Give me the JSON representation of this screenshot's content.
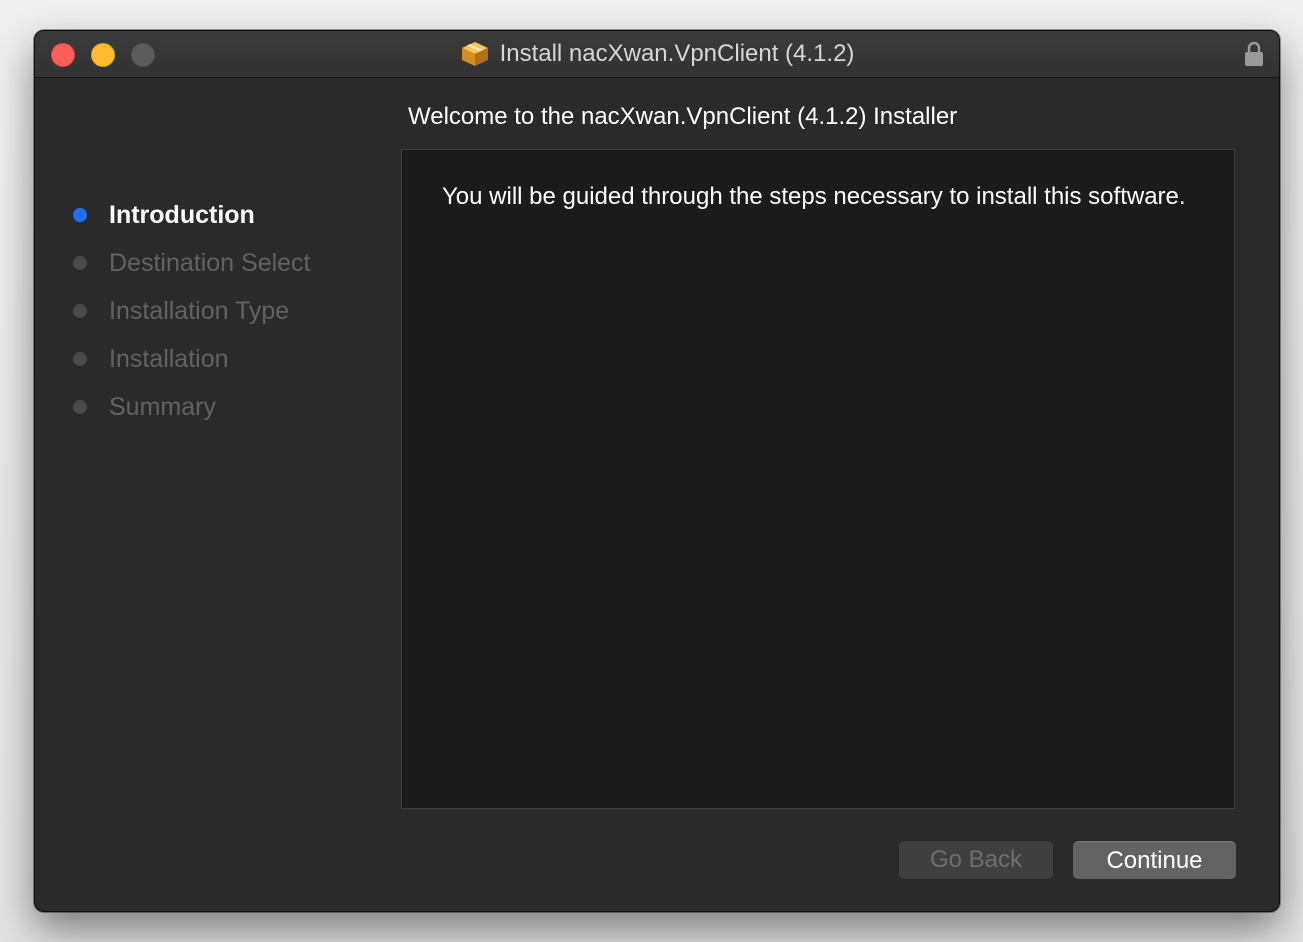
{
  "window": {
    "title": "Install nacXwan.VpnClient (4.1.2)",
    "title_icon": "package-icon",
    "lock_icon": "lock-icon"
  },
  "main": {
    "heading": "Welcome to the nacXwan.VpnClient (4.1.2) Installer",
    "body": "You will be guided through the steps necessary to install this software."
  },
  "sidebar": {
    "steps": [
      {
        "label": "Introduction",
        "active": true
      },
      {
        "label": "Destination Select",
        "active": false
      },
      {
        "label": "Installation Type",
        "active": false
      },
      {
        "label": "Installation",
        "active": false
      },
      {
        "label": "Summary",
        "active": false
      }
    ]
  },
  "buttons": {
    "go_back": "Go Back",
    "continue": "Continue"
  },
  "colors": {
    "active_step_dot": "#1f6ff2",
    "inactive_step_dot": "#4a4a4a",
    "close": "#ff5f57",
    "minimize": "#febc2e",
    "zoom_disabled": "#5c5c5c"
  }
}
